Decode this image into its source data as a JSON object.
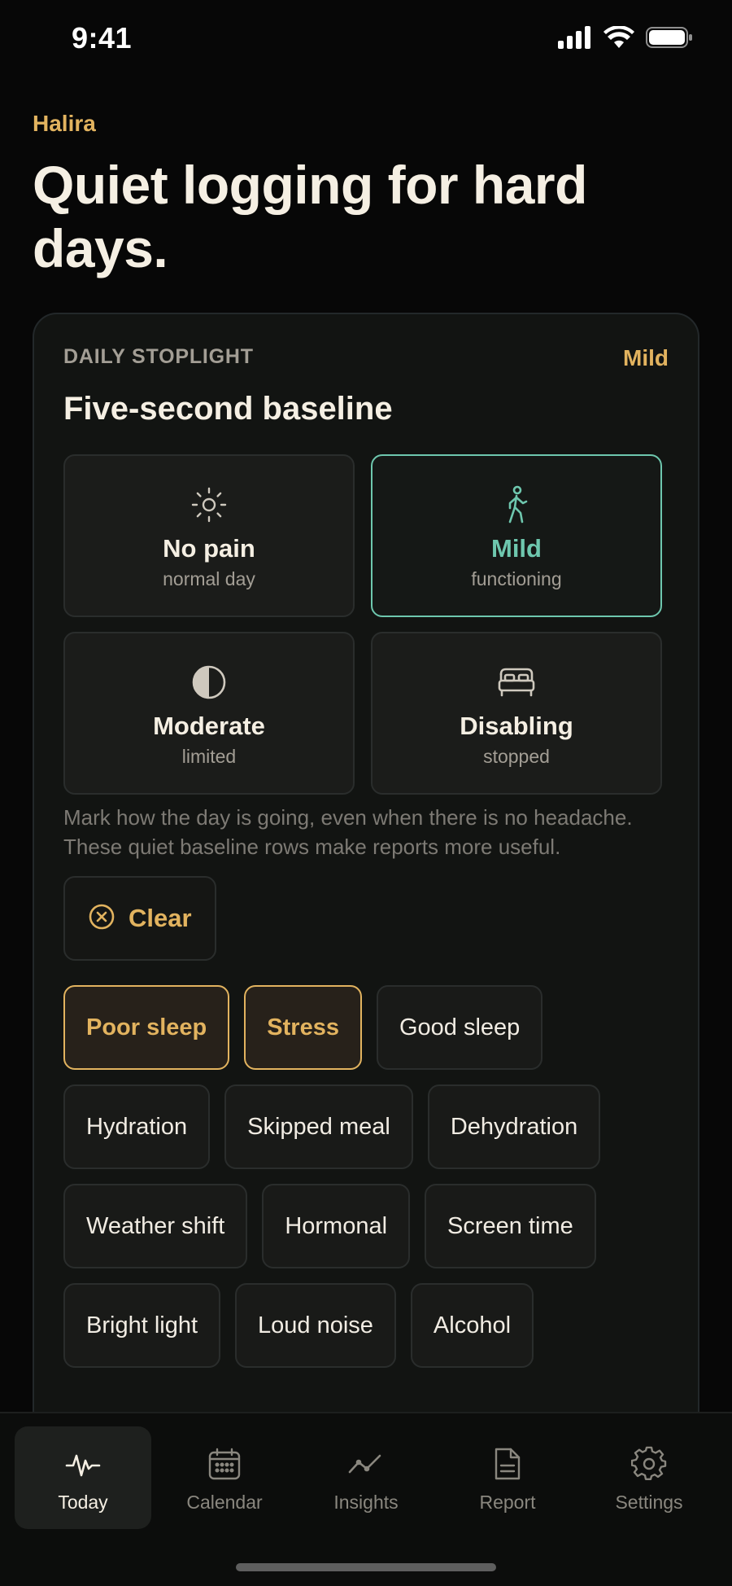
{
  "status_bar": {
    "time": "9:41"
  },
  "brand": "Halira",
  "headline": "Quiet logging for hard days.",
  "card": {
    "eyebrow": "DAILY STOPLIGHT",
    "current_level": "Mild",
    "title": "Five-second baseline",
    "levels": [
      {
        "label": "No pain",
        "sub": "normal day",
        "icon": "sun-icon",
        "selected": false
      },
      {
        "label": "Mild",
        "sub": "functioning",
        "icon": "walking-person-icon",
        "selected": true
      },
      {
        "label": "Moderate",
        "sub": "limited",
        "icon": "half-circle-icon",
        "selected": false
      },
      {
        "label": "Disabling",
        "sub": "stopped",
        "icon": "bed-icon",
        "selected": false
      }
    ],
    "helper_text": "Mark how the day is going, even when there is no headache. These quiet baseline rows make reports more useful.",
    "clear_label": "Clear",
    "tags": [
      {
        "label": "Poor sleep",
        "active": true
      },
      {
        "label": "Stress",
        "active": true
      },
      {
        "label": "Good sleep",
        "active": false
      },
      {
        "label": "Hydration",
        "active": false
      },
      {
        "label": "Skipped meal",
        "active": false
      },
      {
        "label": "Dehydration",
        "active": false
      },
      {
        "label": "Weather shift",
        "active": false
      },
      {
        "label": "Hormonal",
        "active": false
      },
      {
        "label": "Screen time",
        "active": false
      },
      {
        "label": "Bright light",
        "active": false
      },
      {
        "label": "Loud noise",
        "active": false
      },
      {
        "label": "Alcohol",
        "active": false
      }
    ]
  },
  "tabbar": {
    "tabs": [
      {
        "label": "Today",
        "icon": "pulse-icon",
        "active": true
      },
      {
        "label": "Calendar",
        "icon": "calendar-icon",
        "active": false
      },
      {
        "label": "Insights",
        "icon": "trend-line-icon",
        "active": false
      },
      {
        "label": "Report",
        "icon": "document-icon",
        "active": false
      },
      {
        "label": "Settings",
        "icon": "gear-icon",
        "active": false
      }
    ]
  },
  "colors": {
    "accent_gold": "#e2b35f",
    "accent_teal": "#6ec7ae",
    "background": "#070707",
    "card": "#121412"
  }
}
